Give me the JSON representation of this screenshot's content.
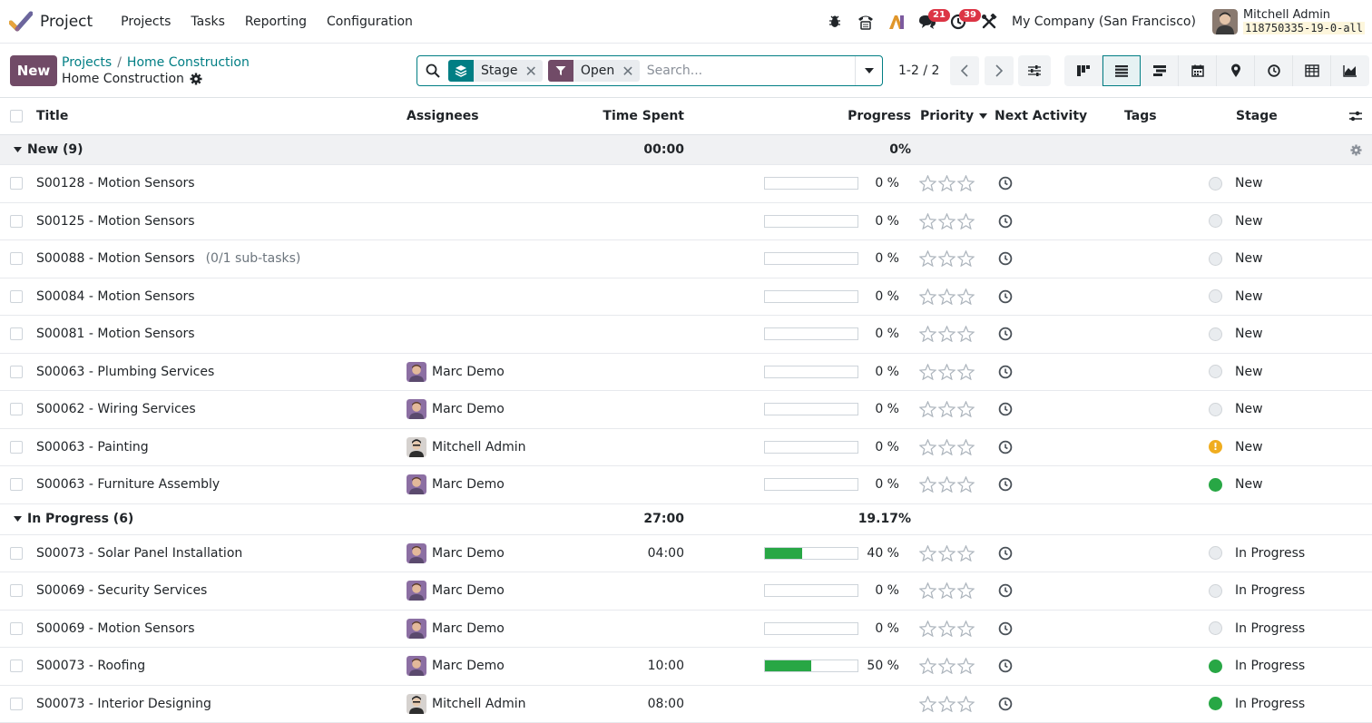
{
  "navbar": {
    "app_name": "Project",
    "menu": [
      "Projects",
      "Tasks",
      "Reporting",
      "Configuration"
    ],
    "chat_badge": "21",
    "activity_badge": "39",
    "company": "My Company (San Francisco)",
    "user_name": "Mitchell Admin",
    "user_db": "118750335-19-0-all"
  },
  "control": {
    "new_label": "New",
    "breadcrumb_parent": "Projects",
    "breadcrumb_sep": "/",
    "breadcrumb_current_link": "Home Construction",
    "page_title": "Home Construction",
    "facets": [
      {
        "label": "Stage",
        "color": "#017e84"
      },
      {
        "label": "Open",
        "color": "#714b67"
      }
    ],
    "search_placeholder": "Search...",
    "pager": "1-2 / 2"
  },
  "columns": {
    "title": "Title",
    "assignees": "Assignees",
    "time_spent": "Time Spent",
    "progress": "Progress",
    "priority": "Priority",
    "next_activity": "Next Activity",
    "tags": "Tags",
    "stage": "Stage"
  },
  "groups": [
    {
      "label": "New (9)",
      "time": "00:00",
      "progress": "0%",
      "rows": [
        {
          "title": "S00128 - Motion Sensors",
          "subtasks": "",
          "assignee": "",
          "avatar": "",
          "time": "",
          "progress": 0,
          "progress_label": "0 %",
          "state": "grey",
          "stage": "New"
        },
        {
          "title": "S00125 - Motion Sensors",
          "subtasks": "",
          "assignee": "",
          "avatar": "",
          "time": "",
          "progress": 0,
          "progress_label": "0 %",
          "state": "grey",
          "stage": "New"
        },
        {
          "title": "S00088 - Motion Sensors",
          "subtasks": "(0/1 sub-tasks)",
          "assignee": "",
          "avatar": "",
          "time": "",
          "progress": 0,
          "progress_label": "0 %",
          "state": "grey",
          "stage": "New"
        },
        {
          "title": "S00084 - Motion Sensors",
          "subtasks": "",
          "assignee": "",
          "avatar": "",
          "time": "",
          "progress": 0,
          "progress_label": "0 %",
          "state": "grey",
          "stage": "New"
        },
        {
          "title": "S00081 - Motion Sensors",
          "subtasks": "",
          "assignee": "",
          "avatar": "",
          "time": "",
          "progress": 0,
          "progress_label": "0 %",
          "state": "grey",
          "stage": "New"
        },
        {
          "title": "S00063 - Plumbing Services",
          "subtasks": "",
          "assignee": "Marc Demo",
          "avatar": "marc",
          "time": "",
          "progress": 0,
          "progress_label": "0 %",
          "state": "grey",
          "stage": "New"
        },
        {
          "title": "S00062 - Wiring Services",
          "subtasks": "",
          "assignee": "Marc Demo",
          "avatar": "marc",
          "time": "",
          "progress": 0,
          "progress_label": "0 %",
          "state": "grey",
          "stage": "New"
        },
        {
          "title": "S00063 - Painting",
          "subtasks": "",
          "assignee": "Mitchell Admin",
          "avatar": "mitchell",
          "time": "",
          "progress": 0,
          "progress_label": "0 %",
          "state": "orange",
          "stage": "New"
        },
        {
          "title": "S00063 - Furniture Assembly",
          "subtasks": "",
          "assignee": "Marc Demo",
          "avatar": "marc",
          "time": "",
          "progress": 0,
          "progress_label": "0 %",
          "state": "green",
          "stage": "New"
        }
      ]
    },
    {
      "label": "In Progress (6)",
      "time": "27:00",
      "progress": "19.17%",
      "rows": [
        {
          "title": "S00073 - Solar Panel Installation",
          "subtasks": "",
          "assignee": "Marc Demo",
          "avatar": "marc",
          "time": "04:00",
          "progress": 40,
          "progress_label": "40 %",
          "state": "grey",
          "stage": "In Progress"
        },
        {
          "title": "S00069 - Security Services",
          "subtasks": "",
          "assignee": "Marc Demo",
          "avatar": "marc",
          "time": "",
          "progress": 0,
          "progress_label": "0 %",
          "state": "grey",
          "stage": "In Progress"
        },
        {
          "title": "S00069 - Motion Sensors",
          "subtasks": "",
          "assignee": "Marc Demo",
          "avatar": "marc",
          "time": "",
          "progress": 0,
          "progress_label": "0 %",
          "state": "grey",
          "stage": "In Progress"
        },
        {
          "title": "S00073 - Roofing",
          "subtasks": "",
          "assignee": "Marc Demo",
          "avatar": "marc",
          "time": "10:00",
          "progress": 50,
          "progress_label": "50 %",
          "state": "green",
          "stage": "In Progress"
        },
        {
          "title": "S00073 - Interior Designing",
          "subtasks": "",
          "assignee": "Mitchell Admin",
          "avatar": "mitchell",
          "time": "08:00",
          "progress": null,
          "progress_label": "",
          "state": "green",
          "stage": "In Progress"
        }
      ]
    }
  ]
}
